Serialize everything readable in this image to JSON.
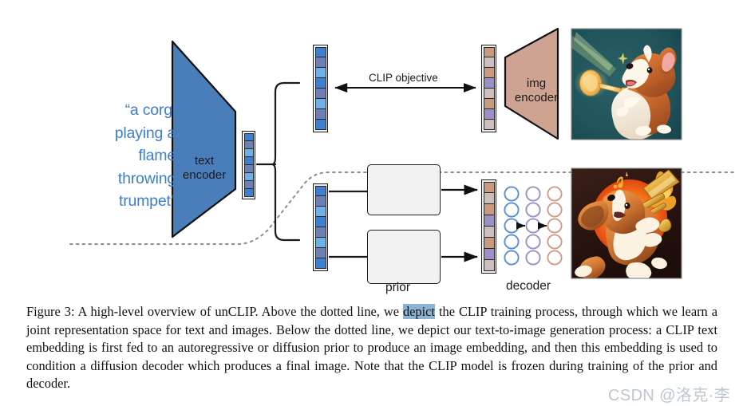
{
  "figure": {
    "prompt": "“a corgi\nplaying a\nflame\nthrowing\ntrumpet”",
    "text_encoder_label": "text\nencoder",
    "img_encoder_label": "img\nencoder",
    "clip_objective_label": "CLIP objective",
    "prior_label": "prior",
    "decoder_label": "decoder",
    "images": {
      "top_alt": "corgi playing a flame throwing trumpet, teal background",
      "bottom_alt": "corgi playing a trombone in front of an orange sun, dark background"
    },
    "colors": {
      "prompt_text": "#3c7fd0",
      "text_encoder_fill": "#4a7ebb",
      "img_encoder_fill": "#cfa392",
      "embed_blue_dark": "#3f7fd0",
      "embed_blue_light": "#6fb0e8",
      "embed_blue_slate": "#6d7fb5",
      "embed_tan": "#c89a82",
      "embed_grey_pink": "#cdbebd",
      "embed_purple": "#9b91c4",
      "box_fill": "#f2f2f2",
      "stroke": "#1a1a1a",
      "highlight": "#8cb4d2"
    },
    "text_embedding_cells": [
      "#3f7fd0",
      "#6d7fb5",
      "#6fb0e8",
      "#3f7fd0",
      "#6d7fb5",
      "#6fb0e8",
      "#6d7fb5",
      "#3f7fd0"
    ],
    "image_embedding_cells": [
      "#c89a82",
      "#cdbebd",
      "#c89a82",
      "#9b91c4",
      "#cdbebd",
      "#c89a82",
      "#9b91c4",
      "#cdbebd"
    ],
    "ar_prior": {
      "circle_count": 5,
      "arc_colors": [
        "#cf9b86",
        "#8e8fc0",
        "#5b8fd4"
      ]
    },
    "diffusion_prior": {
      "rows": 3,
      "column_colors": [
        "#5b8fd4",
        "#9b91c4",
        "#cf9b86"
      ]
    },
    "decoder_grid": {
      "rows": 5,
      "column_colors": [
        "#5b8fd4",
        "#9b91c4",
        "#cf9b86"
      ]
    }
  },
  "caption": {
    "part1": "Figure 3: A high-level overview of unCLIP. Above the dotted line, we ",
    "highlight": "depict",
    "part2": " the CLIP training process, through which we learn a joint representation space for text and images. Below the dotted line, we depict our text-to-image generation process: a CLIP text embedding is first fed to an autoregressive or diffusion prior to produce an image embedding, and then this embedding is used to condition a diffusion decoder which produces a final image. Note that the CLIP model is frozen during training of the prior and decoder."
  },
  "watermark": {
    "text": "CSDN @洛克·李"
  }
}
